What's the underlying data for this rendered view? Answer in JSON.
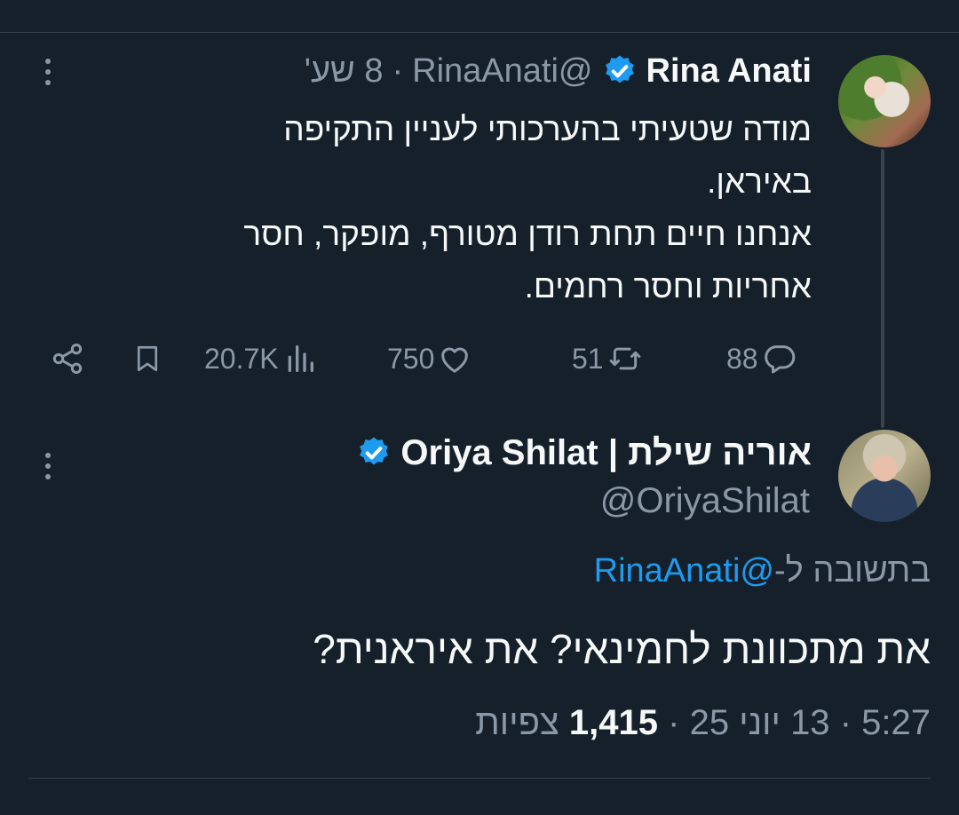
{
  "tweet": {
    "name": "Rina Anati",
    "handle": "@RinaAnati",
    "separator": "·",
    "time": "8 שע'",
    "lines": [
      "מודה שטעיתי בהערכותי לעניין התקיפה",
      "באיראן.",
      "אנחנו חיים תחת רודן מטורף, מופקר, חסר",
      "אחריות וחסר רחמים."
    ],
    "stats": {
      "replies": "88",
      "reposts": "51",
      "likes": "750",
      "views": "20.7K"
    },
    "icons": [
      "reply-icon",
      "repost-icon",
      "like-icon",
      "views-icon",
      "bookmark-icon",
      "share-icon",
      "more-icon",
      "verified-badge-icon"
    ]
  },
  "reply": {
    "name": "אוריה שילת | Oriya Shilat",
    "handle": "@OriyaShilat",
    "replying_prefix": "בתשובה ל-",
    "replying_to": "@RinaAnati",
    "text": "את מתכוונת לחמינאי? את איראנית?",
    "time": "5:27",
    "date": "13 יוני 25",
    "views_count": "1,415",
    "views_label": "צפיות",
    "separator": "·"
  },
  "colors": {
    "background": "#15202b",
    "text": "#f7f9f9",
    "muted": "#8b98a5",
    "accent": "#1d9bf0",
    "divider": "#38444d"
  }
}
